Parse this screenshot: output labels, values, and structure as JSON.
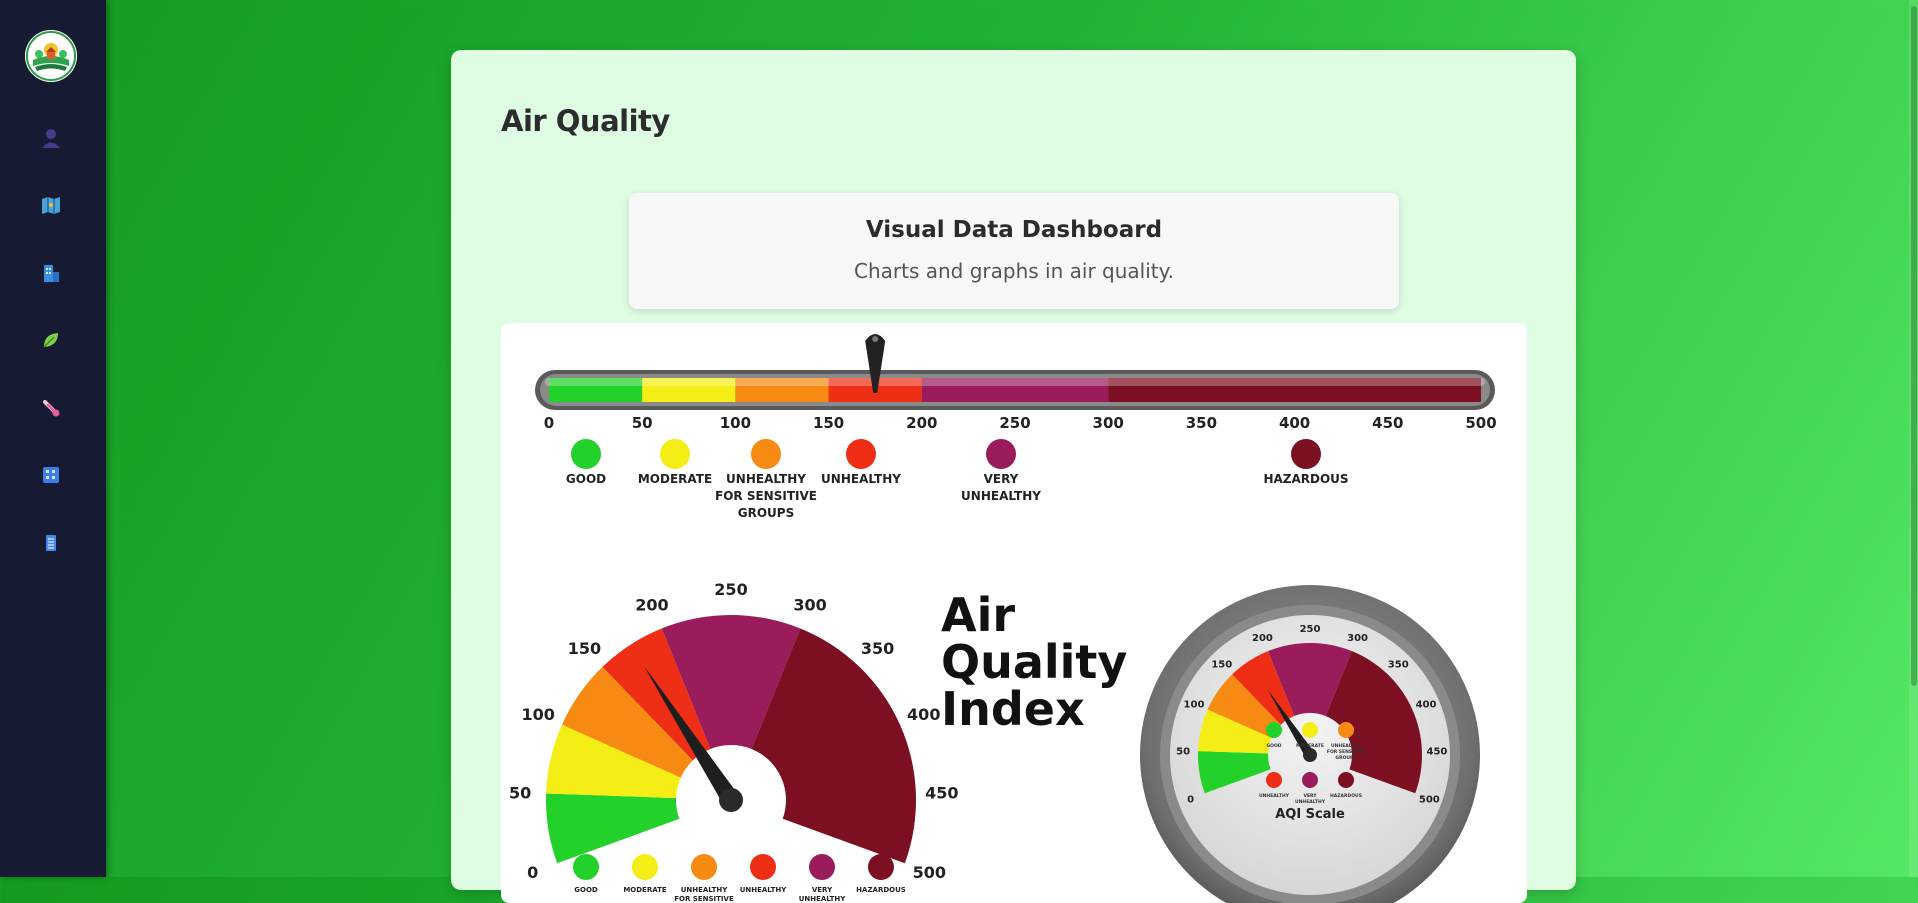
{
  "page": {
    "title": "Air Quality"
  },
  "sidebar": {
    "logo": "community-garden-logo",
    "items": [
      {
        "icon": "user-icon",
        "color": "#4a3a8c"
      },
      {
        "icon": "map-icon",
        "color": "#4aa3d8"
      },
      {
        "icon": "building-icon",
        "color": "#3c8fe0"
      },
      {
        "icon": "leaf-icon",
        "color": "#7fd14a"
      },
      {
        "icon": "thermometer-icon",
        "color": "#e85a9a"
      },
      {
        "icon": "city-grid-icon",
        "color": "#3c7fe8"
      },
      {
        "icon": "list-icon",
        "color": "#4a86e8"
      }
    ]
  },
  "dashboard_card": {
    "title": "Visual Data Dashboard",
    "subtitle": "Charts and graphs in air quality."
  },
  "aqi_infographic": {
    "scale_ticks": [
      "0",
      "50",
      "100",
      "150",
      "200",
      "250",
      "300",
      "350",
      "400",
      "450",
      "500"
    ],
    "pointer_value": 175,
    "categories": [
      {
        "label": [
          "GOOD"
        ],
        "color": "#22d12a"
      },
      {
        "label": [
          "MODERATE"
        ],
        "color": "#f4ee16"
      },
      {
        "label": [
          "UNHEALTHY",
          "FOR SENSITIVE",
          "GROUPS"
        ],
        "color": "#f68a12"
      },
      {
        "label": [
          "UNHEALTHY"
        ],
        "color": "#ef2e16"
      },
      {
        "label": [
          "VERY",
          "UNHEALTHY"
        ],
        "color": "#9b1c5a"
      },
      {
        "label": [
          "HAZARDOUS"
        ],
        "color": "#7d0f22"
      }
    ],
    "gauge_ticks": [
      "0",
      "50",
      "100",
      "150",
      "200",
      "250",
      "300",
      "350",
      "400",
      "450",
      "500"
    ],
    "center_title": [
      "Air",
      "Quality",
      "Index"
    ],
    "dial_caption": "AQI Scale"
  }
}
